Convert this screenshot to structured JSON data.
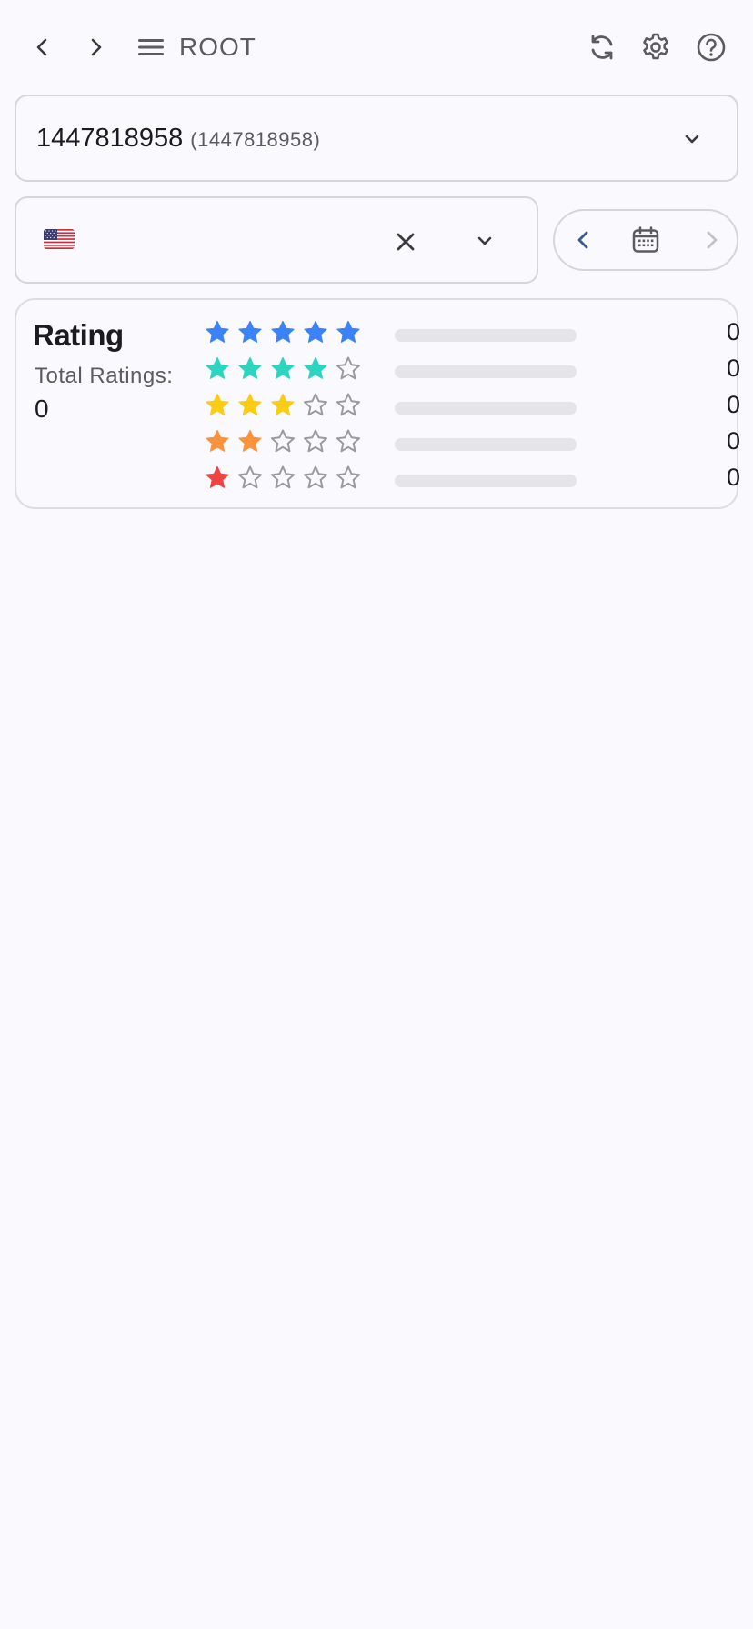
{
  "header": {
    "title": "ROOT",
    "icons": [
      "chevron-left-icon",
      "chevron-right-icon",
      "menu-icon",
      "refresh-icon",
      "gear-icon",
      "help-icon"
    ]
  },
  "app_select": {
    "name": "1447818958",
    "id": "(1447818958)"
  },
  "country_select": {
    "flag": "us-flag-icon",
    "value": ""
  },
  "rating": {
    "title": "Rating",
    "total_label": "Total Ratings:",
    "total_value": "0",
    "rows": [
      {
        "stars": 5,
        "color": "#3b82f6",
        "count": "0",
        "fraction": 0
      },
      {
        "stars": 4,
        "color": "#2dd4bf",
        "count": "0",
        "fraction": 0
      },
      {
        "stars": 3,
        "color": "#facc15",
        "count": "0",
        "fraction": 0
      },
      {
        "stars": 2,
        "color": "#fb923c",
        "count": "0",
        "fraction": 0
      },
      {
        "stars": 1,
        "color": "#ef4444",
        "count": "0",
        "fraction": 0
      }
    ]
  },
  "colors": {
    "background": "#f9f9fe",
    "border": "#d5d5da",
    "icon_gray": "#5b5b60",
    "nav_accent": "#3a5a8c",
    "empty_star": "#9a9aa0"
  }
}
